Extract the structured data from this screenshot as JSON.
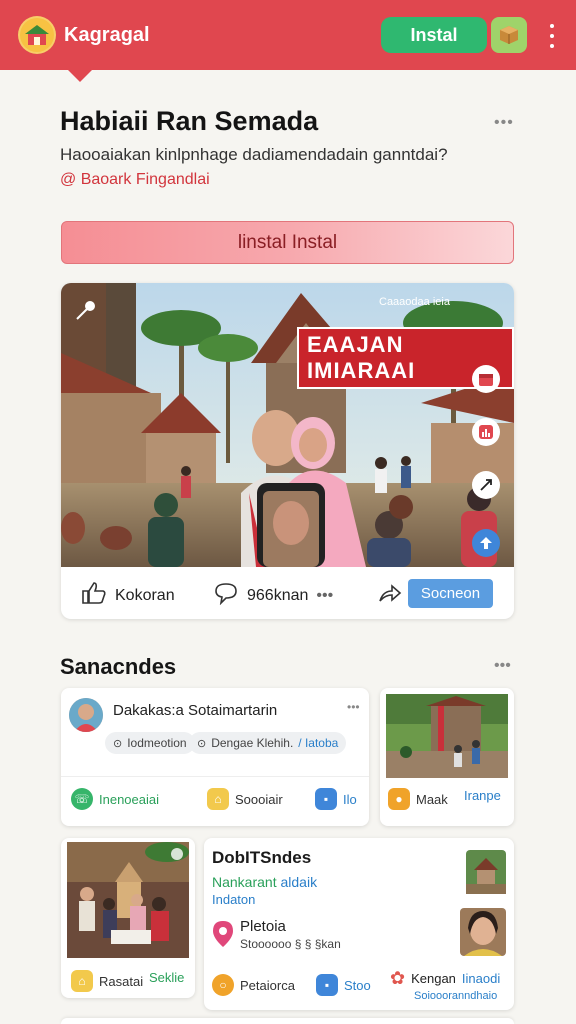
{
  "header": {
    "app_name": "Kagragal",
    "install_label": "Instal",
    "logo_icon": "house-logo-icon",
    "box_icon": "package-icon",
    "menu_icon": "kebab-menu-icon",
    "brand_color": "#e0474f"
  },
  "post": {
    "title": "Habiaii Ran Semada",
    "subtitle": "Haooaiakan kinlpnhage dadiamendadain ganntdai?",
    "author": "@ Baoark Fingandlai",
    "install_bar_label": "linstal Instal",
    "more": "•••"
  },
  "video": {
    "overlay_text": "EAAJAN IMIARAAI",
    "meta": "Caaaodaa ieia",
    "likes_label": "Kokoran",
    "comments_label": "966knan",
    "comments_more": "•••",
    "share_label": "Socneon"
  },
  "section": {
    "title": "Sanacndes",
    "more": "•••"
  },
  "cards": {
    "c1": {
      "name": "Dakakas:a Sotaimartarin",
      "more": "•••",
      "chip1": "Iodmeotion",
      "chip2": "Dengae Klehih.",
      "chip2_link": "/ Iatoba",
      "foot1": "Inenoeaiai",
      "foot2": "Soooiair",
      "foot3": "Ilo"
    },
    "c2": {
      "foot1": "Maak",
      "foot2": "Iranpe"
    },
    "c4": {
      "title": "DobITSndes",
      "green": "Nankarant",
      "green2": "aldaik",
      "blue": "Indaton",
      "place": "Pletoia",
      "place_sub": "Stoooooo § § §kan",
      "foot1": "Petaiorca",
      "foot2": "Stoo",
      "foot3": "Kengan",
      "foot3_link": "Iinaodi",
      "foot3_sub": "Soioooranndhaio"
    },
    "c3": {
      "foot1": "Rasatai",
      "foot2": "Seklie"
    }
  }
}
